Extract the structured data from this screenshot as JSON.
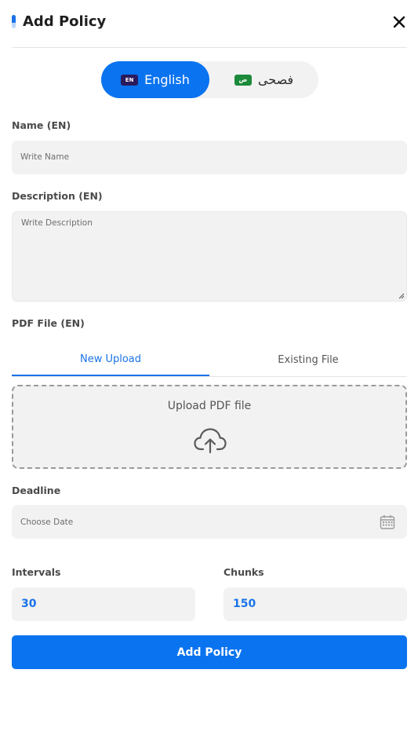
{
  "header": {
    "title": "Add Policy"
  },
  "language": {
    "english": "English",
    "english_flag": "EN",
    "arabic": "فصحى",
    "arabic_flag": "ض"
  },
  "name": {
    "label": "Name (EN)",
    "placeholder": "Write Name"
  },
  "description": {
    "label": "Description (EN)",
    "placeholder": "Write Description"
  },
  "pdf": {
    "label": "PDF File (EN)",
    "tabs": [
      "New Upload",
      "Existing File"
    ],
    "upload_text": "Upload PDF file"
  },
  "deadline": {
    "label": "Deadline",
    "placeholder": "Choose Date"
  },
  "intervals": {
    "label": "Intervals",
    "value": "30"
  },
  "chunks": {
    "label": "Chunks",
    "value": "150"
  },
  "submit": {
    "label": "Add Policy"
  },
  "colors": {
    "primary": "#0a73f0",
    "field_bg": "#f2f2f2"
  }
}
